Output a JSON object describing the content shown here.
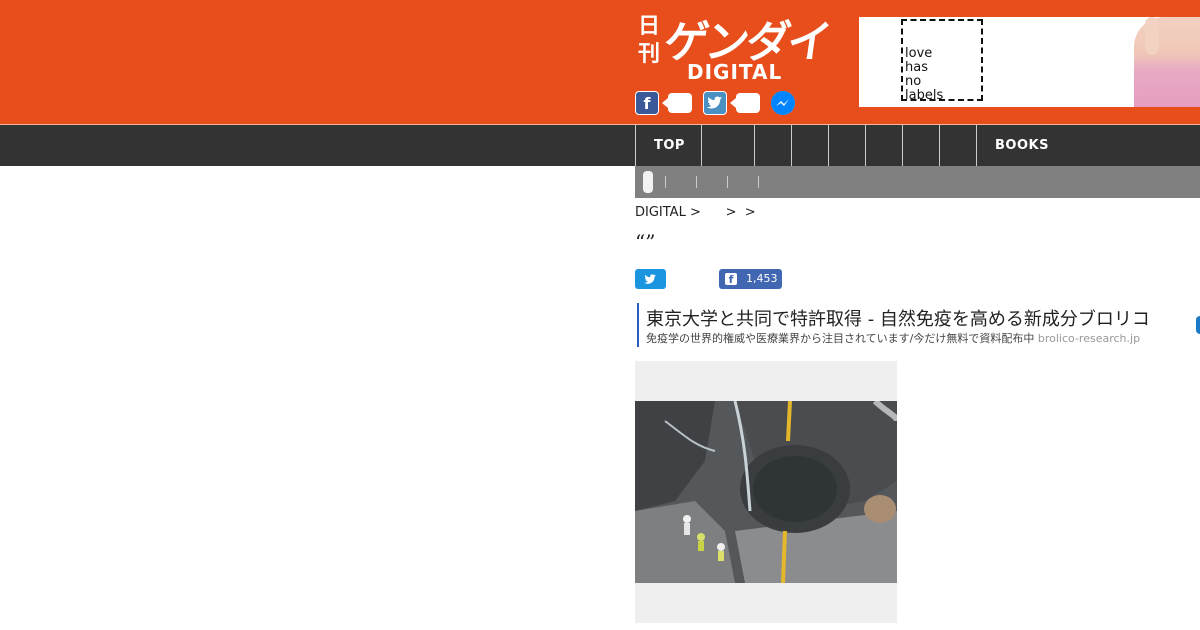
{
  "header": {
    "logo": {
      "kanji": "日刊",
      "main": "ゲンダイ",
      "sub": "DIGITAL"
    },
    "social": {
      "facebook_icon": "facebook-icon",
      "twitter_icon": "twitter-icon",
      "messenger_icon": "messenger-icon"
    },
    "ad": {
      "text": "love\nhas\nno\nlabels"
    },
    "colors": {
      "brand": "#e84e1b",
      "nav": "#333333",
      "subnav": "#808080"
    }
  },
  "nav": {
    "items": [
      {
        "label": "TOP"
      },
      {
        "label": ""
      },
      {
        "label": ""
      },
      {
        "label": ""
      },
      {
        "label": ""
      },
      {
        "label": ""
      },
      {
        "label": ""
      },
      {
        "label": ""
      },
      {
        "label": "BOOKS"
      }
    ]
  },
  "breadcrumb": "DIGITAL >      >  >",
  "article": {
    "title": "“”",
    "share": {
      "facebook_count": "1,453"
    }
  },
  "promo": {
    "title": "東京大学と共同で特許取得 - 自然免疫を高める新成分ブロリコ",
    "description": "免疫学の世界的権威や医療業界から注目されています/今だけ無料で資料配布中",
    "domain": "brolico-research.jp"
  }
}
